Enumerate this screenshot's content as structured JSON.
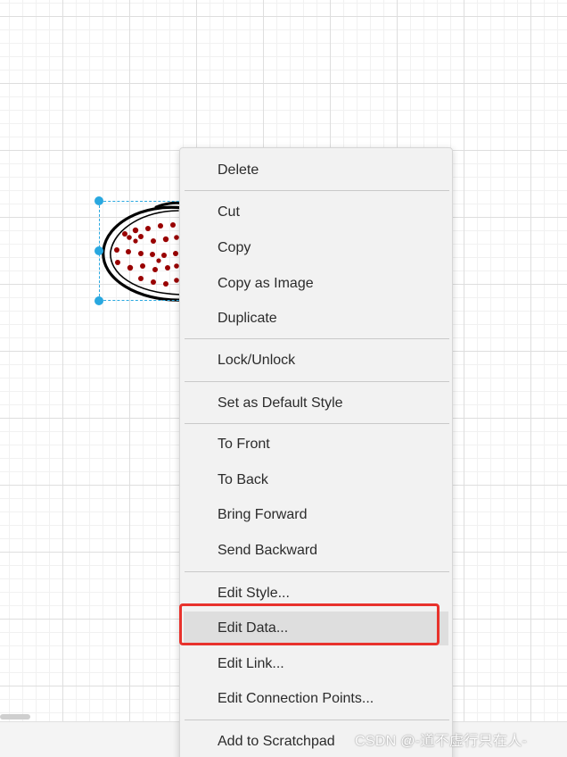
{
  "canvas": {
    "grid": true,
    "selected_shape_icon": "doodle-ellipse-shape",
    "colors": {
      "selection": "#29a8e0",
      "shape_outline": "#000000",
      "shape_fill_dots": "#990000",
      "highlight_outline": "#e8322c"
    }
  },
  "context_menu": {
    "items": [
      {
        "label": "Delete"
      },
      {
        "label": "Cut"
      },
      {
        "label": "Copy"
      },
      {
        "label": "Copy as Image"
      },
      {
        "label": "Duplicate"
      },
      {
        "label": "Lock/Unlock"
      },
      {
        "label": "Set as Default Style"
      },
      {
        "label": "To Front"
      },
      {
        "label": "To Back"
      },
      {
        "label": "Bring Forward"
      },
      {
        "label": "Send Backward"
      },
      {
        "label": "Edit Style..."
      },
      {
        "label": "Edit Data..."
      },
      {
        "label": "Edit Link..."
      },
      {
        "label": "Edit Connection Points..."
      },
      {
        "label": "Add to Scratchpad"
      }
    ],
    "highlighted_label": "Edit Data..."
  },
  "watermark": {
    "text": "CSDN @-道不虚行只在人-"
  }
}
